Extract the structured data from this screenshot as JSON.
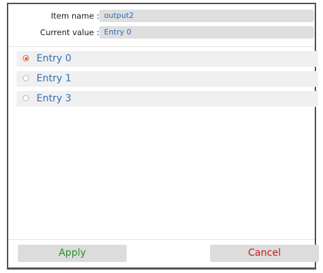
{
  "form": {
    "item_name_label": "Item name :",
    "item_name_value": "output2",
    "current_value_label": "Current value :",
    "current_value_value": "Entry 0"
  },
  "options": [
    {
      "label": "Entry 0",
      "selected": true,
      "icon": "radio-checked-icon"
    },
    {
      "label": "Entry 1",
      "selected": false,
      "icon": "radio-unchecked-icon"
    },
    {
      "label": "Entry 3",
      "selected": false,
      "icon": "radio-unchecked-icon"
    }
  ],
  "buttons": {
    "apply_label": "Apply",
    "cancel_label": "Cancel"
  },
  "colors": {
    "value_text": "#2f6fb3",
    "radio_selected": "#d25a2c",
    "apply_text": "#2e8b2e",
    "cancel_text": "#d11818"
  }
}
